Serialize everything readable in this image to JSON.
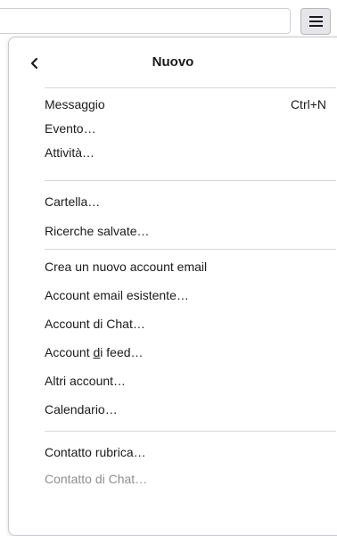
{
  "toolbar": {
    "menu_icon": "hamburger-menu-icon"
  },
  "panel": {
    "back_icon": "chevron-left-icon",
    "title": "Nuovo"
  },
  "groups": [
    [
      {
        "label": "Messaggio",
        "shortcut": "Ctrl+N"
      },
      {
        "label": "Evento…"
      },
      {
        "label": "Attività…"
      }
    ],
    [
      {
        "label": "Cartella…"
      },
      {
        "label": "Ricerche salvate…"
      }
    ],
    [
      {
        "label": "Crea un nuovo account email"
      },
      {
        "label": "Account email esistente…"
      },
      {
        "label": "Account di Chat…"
      },
      {
        "label_pre": "Account ",
        "label_accel": "d",
        "label_post": "i feed…"
      },
      {
        "label": "Altri account…"
      },
      {
        "label": "Calendario…"
      }
    ],
    [
      {
        "label": "Contatto rubrica…"
      },
      {
        "label": "Contatto di Chat…",
        "disabled": true
      }
    ]
  ]
}
